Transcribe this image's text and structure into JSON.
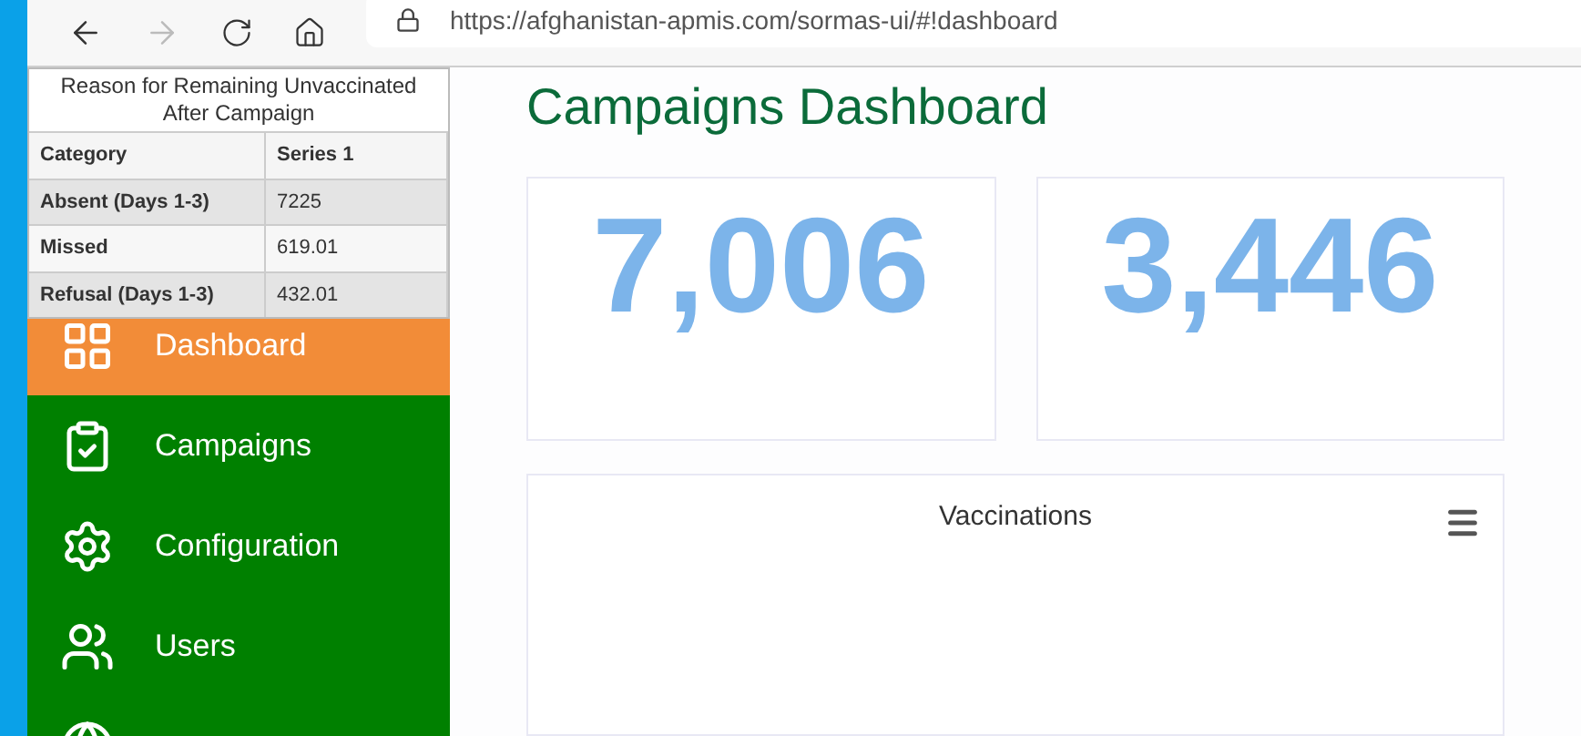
{
  "browser": {
    "url": "https://afghanistan-apmis.com/sormas-ui/#!dashboard"
  },
  "data_table": {
    "title": "Reason for Remaining Unvaccinated After Campaign",
    "columns": [
      "Category",
      "Series 1"
    ],
    "rows": [
      {
        "category": "Absent (Days 1-3)",
        "value": "7225"
      },
      {
        "category": "Missed",
        "value": "619.01"
      },
      {
        "category": "Refusal (Days 1-3)",
        "value": "432.01"
      }
    ]
  },
  "sidebar": {
    "items": [
      {
        "label": "Dashboard",
        "selected": true
      },
      {
        "label": "Campaigns",
        "selected": false
      },
      {
        "label": "Configuration",
        "selected": false
      },
      {
        "label": "Users",
        "selected": false
      }
    ]
  },
  "page_title": "Campaigns Dashboard",
  "stat_cards": [
    "7,006",
    "3,446"
  ],
  "chart_card": {
    "title": "Vaccinations"
  }
}
